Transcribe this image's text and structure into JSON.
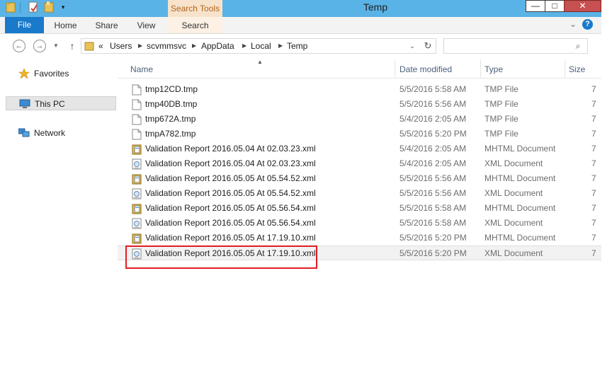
{
  "window": {
    "title": "Temp",
    "context_tab_title": "Search Tools",
    "controls": {
      "minimize": "—",
      "maximize": "□",
      "close": "✕"
    }
  },
  "ribbon": {
    "file_tab": "File",
    "tabs": [
      "Home",
      "Share",
      "View",
      "Search"
    ],
    "help": "?"
  },
  "address": {
    "overflow": "«",
    "crumbs": [
      "Users",
      "scvmmsvc",
      "AppData",
      "Local",
      "Temp"
    ],
    "search_placeholder": ""
  },
  "nav": {
    "items": [
      {
        "label": "Favorites",
        "icon": "star-icon"
      },
      {
        "label": "This PC",
        "icon": "computer-icon"
      },
      {
        "label": "Network",
        "icon": "network-icon"
      }
    ]
  },
  "columns": {
    "name": "Name",
    "date": "Date modified",
    "type": "Type",
    "size": "Size"
  },
  "files": [
    {
      "name": "tmp12CD.tmp",
      "date": "5/5/2016 5:58 AM",
      "type": "TMP File",
      "size": "7",
      "icon": "tmp-file-icon"
    },
    {
      "name": "tmp40DB.tmp",
      "date": "5/5/2016 5:56 AM",
      "type": "TMP File",
      "size": "7",
      "icon": "tmp-file-icon"
    },
    {
      "name": "tmp672A.tmp",
      "date": "5/4/2016 2:05 AM",
      "type": "TMP File",
      "size": "7",
      "icon": "tmp-file-icon"
    },
    {
      "name": "tmpA782.tmp",
      "date": "5/5/2016 5:20 PM",
      "type": "TMP File",
      "size": "7",
      "icon": "tmp-file-icon"
    },
    {
      "name": "Validation Report 2016.05.04 At 02.03.23.xml",
      "date": "5/4/2016 2:05 AM",
      "type": "MHTML Document",
      "size": "7",
      "icon": "mhtml-file-icon"
    },
    {
      "name": "Validation Report 2016.05.04 At 02.03.23.xml",
      "date": "5/4/2016 2:05 AM",
      "type": "XML Document",
      "size": "7",
      "icon": "xml-file-icon"
    },
    {
      "name": "Validation Report 2016.05.05 At 05.54.52.xml",
      "date": "5/5/2016 5:56 AM",
      "type": "MHTML Document",
      "size": "7",
      "icon": "mhtml-file-icon"
    },
    {
      "name": "Validation Report 2016.05.05 At 05.54.52.xml",
      "date": "5/5/2016 5:56 AM",
      "type": "XML Document",
      "size": "7",
      "icon": "xml-file-icon"
    },
    {
      "name": "Validation Report 2016.05.05 At 05.56.54.xml",
      "date": "5/5/2016 5:58 AM",
      "type": "MHTML Document",
      "size": "7",
      "icon": "mhtml-file-icon"
    },
    {
      "name": "Validation Report 2016.05.05 At 05.56.54.xml",
      "date": "5/5/2016 5:58 AM",
      "type": "XML Document",
      "size": "7",
      "icon": "xml-file-icon"
    },
    {
      "name": "Validation Report 2016.05.05 At 17.19.10.xml",
      "date": "5/5/2016 5:20 PM",
      "type": "MHTML Document",
      "size": "7",
      "icon": "mhtml-file-icon"
    },
    {
      "name": "Validation Report 2016.05.05 At 17.19.10.xml",
      "date": "5/5/2016 5:20 PM",
      "type": "XML Document",
      "size": "7",
      "icon": "xml-file-icon",
      "selected": true
    }
  ],
  "colors": {
    "titlebar": "#5ab3e6",
    "file_tab": "#1979ca",
    "context_tab": "#f7e3cb",
    "highlight": "#e21d22"
  }
}
